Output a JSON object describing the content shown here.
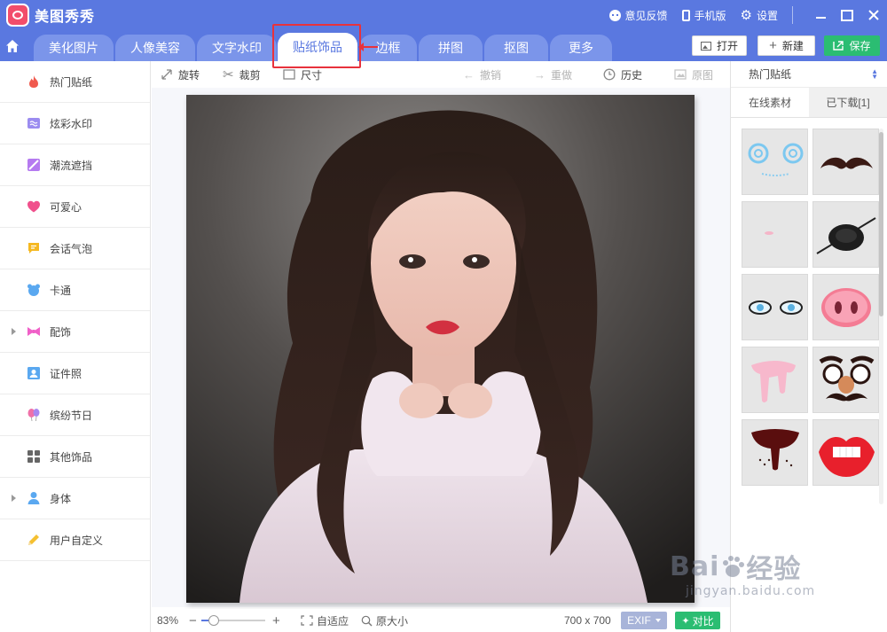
{
  "app": {
    "title": "美图秀秀",
    "feedback": "意见反馈",
    "mobile": "手机版",
    "settings": "设置"
  },
  "tabs": [
    {
      "label": "美化图片"
    },
    {
      "label": "人像美容"
    },
    {
      "label": "文字水印"
    },
    {
      "label": "贴纸饰品"
    },
    {
      "label": "边框"
    },
    {
      "label": "拼图"
    },
    {
      "label": "抠图"
    },
    {
      "label": "更多"
    }
  ],
  "header_buttons": {
    "open": "打开",
    "new": "新建",
    "save": "保存"
  },
  "sidebar": {
    "items": [
      {
        "label": "热门贴纸",
        "icon": "flame-icon",
        "color": "#f05a4e",
        "expandable": false
      },
      {
        "label": "炫彩水印",
        "icon": "watermark-icon",
        "color": "#9b8cf0",
        "expandable": false
      },
      {
        "label": "潮流遮挡",
        "icon": "mask-icon",
        "color": "#b57af0",
        "expandable": false
      },
      {
        "label": "可爱心",
        "icon": "heart-icon",
        "color": "#f0508c",
        "expandable": false
      },
      {
        "label": "会话气泡",
        "icon": "speech-bubble-icon",
        "color": "#f5b820",
        "expandable": false
      },
      {
        "label": "卡通",
        "icon": "bear-icon",
        "color": "#5aa8f0",
        "expandable": false
      },
      {
        "label": "配饰",
        "icon": "bow-icon",
        "color": "#f060c8",
        "expandable": true
      },
      {
        "label": "证件照",
        "icon": "id-photo-icon",
        "color": "#5aa8f0",
        "expandable": false
      },
      {
        "label": "缤纷节日",
        "icon": "balloon-icon",
        "color": "#f070a8",
        "expandable": false
      },
      {
        "label": "其他饰品",
        "icon": "grid-icon",
        "color": "#666666",
        "expandable": false
      },
      {
        "label": "身体",
        "icon": "person-icon",
        "color": "#5aa8f0",
        "expandable": true
      },
      {
        "label": "用户自定义",
        "icon": "pencil-icon",
        "color": "#f5c030",
        "expandable": false
      }
    ]
  },
  "toolbar": {
    "rotate": "旋转",
    "crop": "裁剪",
    "size": "尺寸",
    "undo": "撤销",
    "redo": "重做",
    "history": "历史",
    "original": "原图"
  },
  "status": {
    "zoom": "83%",
    "zoom_level": 0.2,
    "fit": "自适应",
    "actual": "原大小",
    "dimensions": "700 x 700",
    "exif": "EXIF",
    "compare": "对比"
  },
  "right_panel": {
    "category": "热门贴纸",
    "tabs": [
      "在线素材",
      "已下载[1]"
    ]
  },
  "watermark": {
    "brand": "Bai",
    "brand2": "经验",
    "url": "jingyan.baidu.com"
  }
}
